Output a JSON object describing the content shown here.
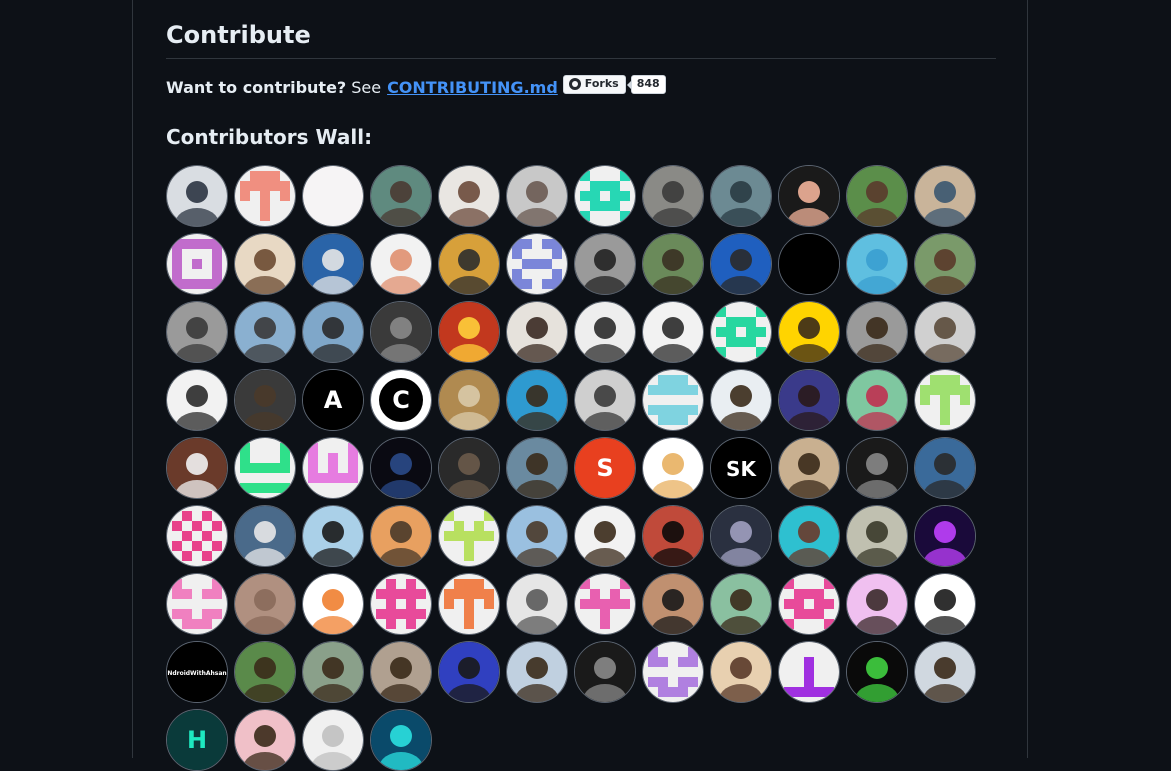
{
  "section": {
    "title": "Contribute",
    "want_text": "Want to contribute?",
    "see_text": "See",
    "link_text": "CONTRIBUTING.md",
    "badge": {
      "label": "Forks",
      "count": "848"
    },
    "wall_title": "Contributors Wall:"
  },
  "contributors": [
    {
      "kind": "photo",
      "fg": "#2b3442",
      "bg": "#d9dde2"
    },
    {
      "kind": "identicon",
      "color": "#f08f80",
      "pattern": "t"
    },
    {
      "kind": "blank",
      "color": "#f6f4f5"
    },
    {
      "kind": "photo",
      "fg": "#4a3a33",
      "bg": "#5f8a7f"
    },
    {
      "kind": "photo",
      "fg": "#6b4a3b",
      "bg": "#e9e6e2"
    },
    {
      "kind": "photo",
      "fg": "#6a5a52",
      "bg": "#c8c8c8"
    },
    {
      "kind": "identicon",
      "color": "#27d7b4",
      "pattern": "x"
    },
    {
      "kind": "photo",
      "fg": "#3a3a3a",
      "bg": "#8a8a86"
    },
    {
      "kind": "photo",
      "fg": "#2a3b44",
      "bg": "#6c8a93"
    },
    {
      "kind": "photo",
      "fg": "#f2b39a",
      "bg": "#1a1a1a"
    },
    {
      "kind": "photo",
      "fg": "#5a3a2c",
      "bg": "#5b8e4a"
    },
    {
      "kind": "photo",
      "fg": "#3a5770",
      "bg": "#c9b49a"
    },
    {
      "kind": "identicon",
      "color": "#c16ccc",
      "pattern": "sq"
    },
    {
      "kind": "photo",
      "fg": "#6b4a32",
      "bg": "#e8d9c4"
    },
    {
      "kind": "photo",
      "fg": "#e6e6e6",
      "bg": "#2a64a8"
    },
    {
      "kind": "photo",
      "fg": "#e09070",
      "bg": "#f2f2f2"
    },
    {
      "kind": "photo",
      "fg": "#2e2e2e",
      "bg": "#d7a03a"
    },
    {
      "kind": "identicon",
      "color": "#7b86d9",
      "pattern": "d"
    },
    {
      "kind": "photo",
      "fg": "#222222",
      "bg": "#9a9a9a"
    },
    {
      "kind": "photo",
      "fg": "#3a3022",
      "bg": "#6a8a5a"
    },
    {
      "kind": "photo",
      "fg": "#2a2a2a",
      "bg": "#1f5fbf"
    },
    {
      "kind": "blank",
      "color": "#000000"
    },
    {
      "kind": "photo",
      "fg": "#3a9fd0",
      "bg": "#5fbfe0"
    },
    {
      "kind": "photo",
      "fg": "#5a3a2a",
      "bg": "#7a9a6a"
    },
    {
      "kind": "photo",
      "fg": "#3a3a3a",
      "bg": "#9a9a9a"
    },
    {
      "kind": "photo",
      "fg": "#3a3a3a",
      "bg": "#8ab0d0"
    },
    {
      "kind": "photo",
      "fg": "#2a2a2a",
      "bg": "#7fa7c9"
    },
    {
      "kind": "photo",
      "fg": "#8a8a8a",
      "bg": "#3a3a3a"
    },
    {
      "kind": "photo",
      "fg": "#ffcf3a",
      "bg": "#c2381e"
    },
    {
      "kind": "photo",
      "fg": "#3a2a22",
      "bg": "#e6e2dc"
    },
    {
      "kind": "photo",
      "fg": "#2a2a2a",
      "bg": "#eeeeee"
    },
    {
      "kind": "photo",
      "fg": "#2a2a2a",
      "bg": "#f2f2f2"
    },
    {
      "kind": "identicon",
      "color": "#27d7a0",
      "pattern": "x"
    },
    {
      "kind": "photo",
      "fg": "#3a2a1a",
      "bg": "#ffd400"
    },
    {
      "kind": "photo",
      "fg": "#3a2a1a",
      "bg": "#9a9a9a"
    },
    {
      "kind": "photo",
      "fg": "#5a4a3a",
      "bg": "#d0d0d0"
    },
    {
      "kind": "photo",
      "fg": "#2a2a2a",
      "bg": "#f2f2f2"
    },
    {
      "kind": "photo",
      "fg": "#4a3a2a",
      "bg": "#3a3a3a"
    },
    {
      "kind": "logo",
      "fg": "#ffffff",
      "bg": "#000000",
      "glyph": "A"
    },
    {
      "kind": "logo",
      "fg": "#000000",
      "bg": "#ffffff",
      "glyph": "C",
      "ring": true
    },
    {
      "kind": "photo",
      "fg": "#d9c9a9",
      "bg": "#b08a50"
    },
    {
      "kind": "photo",
      "fg": "#3a2a1a",
      "bg": "#2e9ad0"
    },
    {
      "kind": "photo",
      "fg": "#3a3a3a",
      "bg": "#cfcfcf"
    },
    {
      "kind": "identicon",
      "color": "#7fd3e0",
      "pattern": "h"
    },
    {
      "kind": "photo",
      "fg": "#3a2a1a",
      "bg": "#e9eef2"
    },
    {
      "kind": "photo",
      "fg": "#2a1a1a",
      "bg": "#3a3a8a"
    },
    {
      "kind": "photo",
      "fg": "#c03050",
      "bg": "#7fc7a0"
    },
    {
      "kind": "identicon",
      "color": "#9fe070",
      "pattern": "t"
    },
    {
      "kind": "photo",
      "fg": "#f2f2f2",
      "bg": "#6a3a2a"
    },
    {
      "kind": "identicon",
      "color": "#2fe08a",
      "pattern": "u"
    },
    {
      "kind": "identicon",
      "color": "#e67ce0",
      "pattern": "w"
    },
    {
      "kind": "photo",
      "fg": "#2a4a8a",
      "bg": "#0a0a12"
    },
    {
      "kind": "photo",
      "fg": "#6a5a4a",
      "bg": "#2a2a2a"
    },
    {
      "kind": "photo",
      "fg": "#3a2a1a",
      "bg": "#6a8aa0"
    },
    {
      "kind": "logo",
      "fg": "#ffffff",
      "bg": "#e8401f",
      "glyph": "S"
    },
    {
      "kind": "photo",
      "fg": "#e8b060",
      "bg": "#ffffff"
    },
    {
      "kind": "logo",
      "fg": "#ffffff",
      "bg": "#000000",
      "glyph": "SK"
    },
    {
      "kind": "photo",
      "fg": "#3a2a1a",
      "bg": "#c9b090"
    },
    {
      "kind": "photo",
      "fg": "#888888",
      "bg": "#1a1a1a"
    },
    {
      "kind": "photo",
      "fg": "#2a2a2a",
      "bg": "#3a6a9a"
    },
    {
      "kind": "identicon",
      "color": "#e8418a",
      "pattern": "o"
    },
    {
      "kind": "photo",
      "fg": "#e8e8e8",
      "bg": "#4a6a8a"
    },
    {
      "kind": "photo",
      "fg": "#1a1a1a",
      "bg": "#aad0e8"
    },
    {
      "kind": "photo",
      "fg": "#4a3a2a",
      "bg": "#e8a060"
    },
    {
      "kind": "identicon",
      "color": "#b8e060",
      "pattern": "y"
    },
    {
      "kind": "photo",
      "fg": "#4a3a2a",
      "bg": "#9ac0e0"
    },
    {
      "kind": "photo",
      "fg": "#3a2a1a",
      "bg": "#f2f2f2"
    },
    {
      "kind": "photo",
      "fg": "#0a0a0a",
      "bg": "#c04a3a"
    },
    {
      "kind": "photo",
      "fg": "#a0a0c0",
      "bg": "#2a3040"
    },
    {
      "kind": "photo",
      "fg": "#6a3a2a",
      "bg": "#2ec0d0"
    },
    {
      "kind": "photo",
      "fg": "#3a3a2a",
      "bg": "#c0c0b0"
    },
    {
      "kind": "photo",
      "fg": "#c040ff",
      "bg": "#1a0a3a"
    },
    {
      "kind": "identicon",
      "color": "#f080c0",
      "pattern": "m"
    },
    {
      "kind": "photo",
      "fg": "#8a6a5a",
      "bg": "#b09080"
    },
    {
      "kind": "photo",
      "fg": "#f08030",
      "bg": "#ffffff"
    },
    {
      "kind": "identicon",
      "color": "#e84a9a",
      "pattern": "hash"
    },
    {
      "kind": "identicon",
      "color": "#f0804a",
      "pattern": "t"
    },
    {
      "kind": "photo",
      "fg": "#5a5a5a",
      "bg": "#e6e6e6"
    },
    {
      "kind": "identicon",
      "color": "#e860b0",
      "pattern": "y"
    },
    {
      "kind": "photo",
      "fg": "#1a1a1a",
      "bg": "#c09070"
    },
    {
      "kind": "photo",
      "fg": "#3a2a1a",
      "bg": "#8ac0a0"
    },
    {
      "kind": "identicon",
      "color": "#e84a9a",
      "pattern": "x"
    },
    {
      "kind": "photo",
      "fg": "#3a2a2a",
      "bg": "#f0c0f0"
    },
    {
      "kind": "photo",
      "fg": "#1a1a1a",
      "bg": "#ffffff"
    },
    {
      "kind": "logo",
      "fg": "#ffffff",
      "bg": "#000000",
      "glyph": "NdroidWithAhsan"
    },
    {
      "kind": "photo",
      "fg": "#3a2a1a",
      "bg": "#5a8a4a"
    },
    {
      "kind": "photo",
      "fg": "#3a2a1a",
      "bg": "#8aa08a"
    },
    {
      "kind": "photo",
      "fg": "#3a2a1a",
      "bg": "#b0a090"
    },
    {
      "kind": "photo",
      "fg": "#1a1a1a",
      "bg": "#3040c0"
    },
    {
      "kind": "photo",
      "fg": "#3a2a1a",
      "bg": "#c0d0e0"
    },
    {
      "kind": "photo",
      "fg": "#8a8a8a",
      "bg": "#1a1a1a"
    },
    {
      "kind": "identicon",
      "color": "#b080e0",
      "pattern": "m"
    },
    {
      "kind": "photo",
      "fg": "#5a3a2a",
      "bg": "#e8d0b0"
    },
    {
      "kind": "identicon",
      "color": "#a030e0",
      "pattern": "b"
    },
    {
      "kind": "photo",
      "fg": "#40d040",
      "bg": "#0a0a0a"
    },
    {
      "kind": "photo",
      "fg": "#3a2a1a",
      "bg": "#d0d8e0"
    },
    {
      "kind": "logo",
      "fg": "#1ee8c0",
      "bg": "#0a3a3a",
      "glyph": "H"
    },
    {
      "kind": "photo",
      "fg": "#3a2a1a",
      "bg": "#f0c0c8"
    },
    {
      "kind": "photo",
      "fg": "#c0c0c0",
      "bg": "#f0f0f0"
    },
    {
      "kind": "photo",
      "fg": "#2ae0e0",
      "bg": "#0a4a6a"
    }
  ]
}
